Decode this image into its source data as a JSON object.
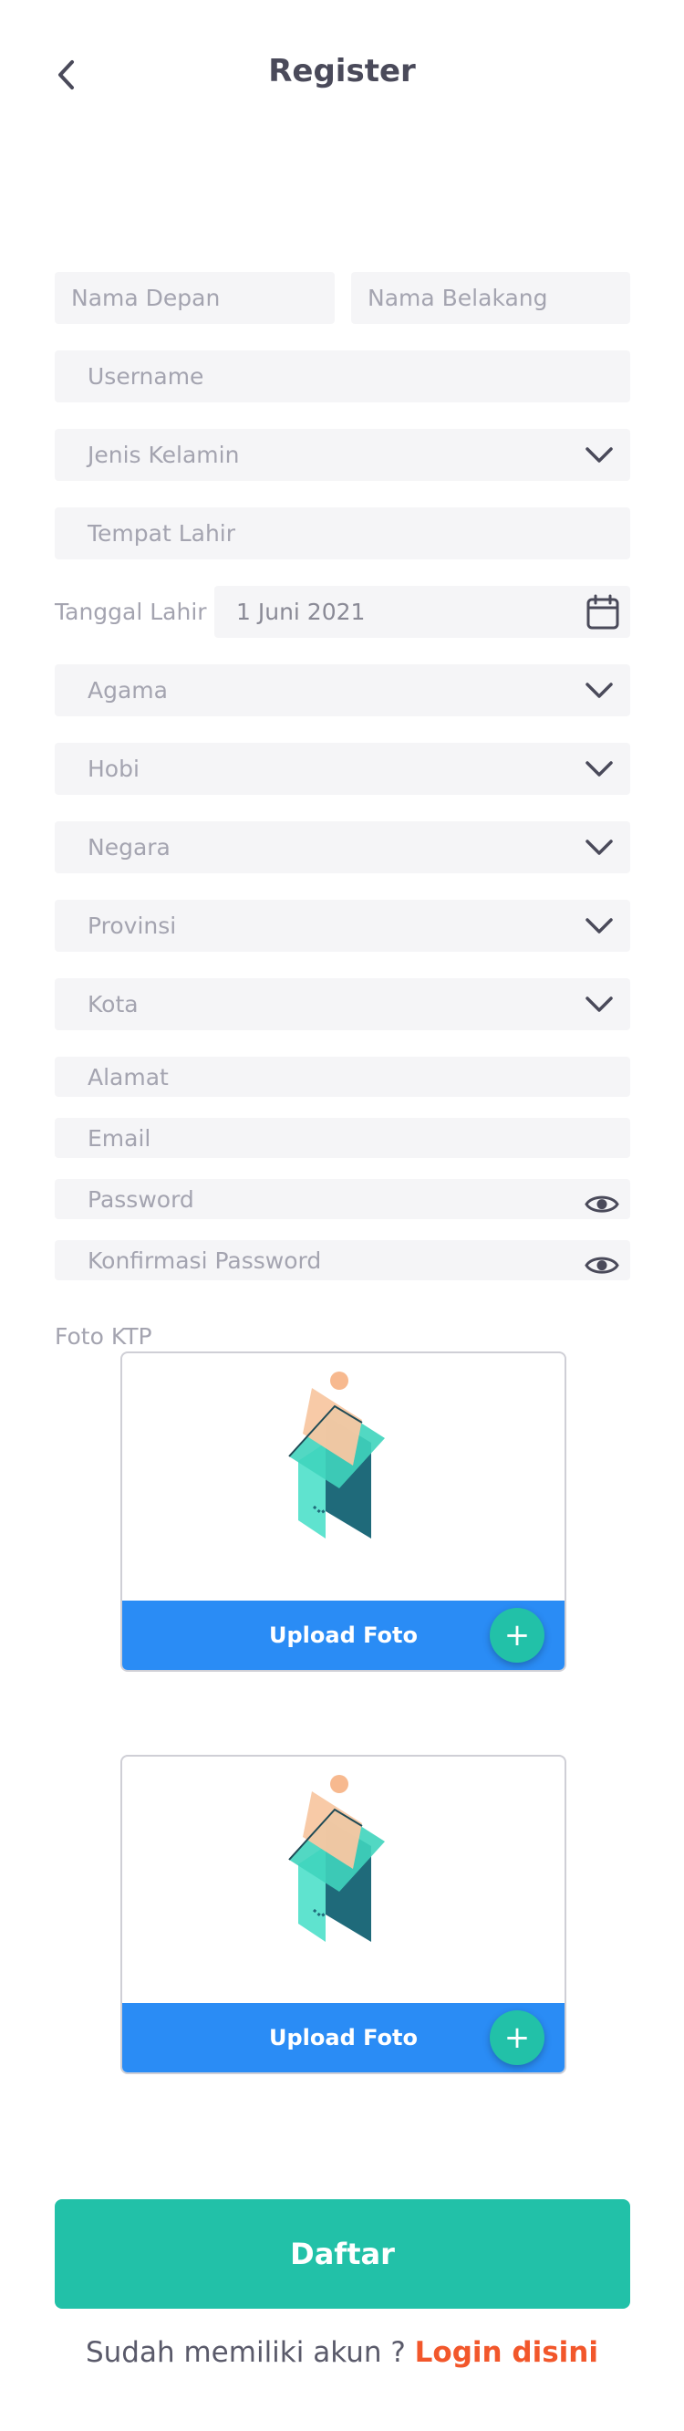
{
  "header": {
    "title": "Register"
  },
  "form": {
    "first_name_placeholder": "Nama Depan",
    "last_name_placeholder": "Nama Belakang",
    "username_placeholder": "Username",
    "gender_placeholder": "Jenis Kelamin",
    "birthplace_placeholder": "Tempat Lahir",
    "birthdate_label": "Tanggal Lahir",
    "birthdate_value": "1 Juni 2021",
    "religion_placeholder": "Agama",
    "hobby_placeholder": "Hobi",
    "country_placeholder": "Negara",
    "province_placeholder": "Provinsi",
    "city_placeholder": "Kota",
    "address_placeholder": "Alamat",
    "email_placeholder": "Email",
    "password_placeholder": "Password",
    "confirm_password_placeholder": "Konfirmasi Password",
    "ktp_label": "Foto KTP"
  },
  "uploads": [
    {
      "label": "Upload Foto",
      "plus": "+"
    },
    {
      "label": "Upload Foto",
      "plus": "+"
    }
  ],
  "submit": {
    "label": "Daftar"
  },
  "footer": {
    "prompt": "Sudah memiliki akun ? ",
    "link": "Login disini"
  },
  "colors": {
    "accent": "#22c1a8",
    "upload_bar": "#2a8cf5",
    "link": "#f2572b",
    "field_bg": "#f5f5f7"
  },
  "icons": {
    "back": "chevron-left-icon",
    "dropdown": "chevron-down-icon",
    "calendar": "calendar-icon",
    "eye": "eye-icon",
    "plus": "plus-icon"
  }
}
